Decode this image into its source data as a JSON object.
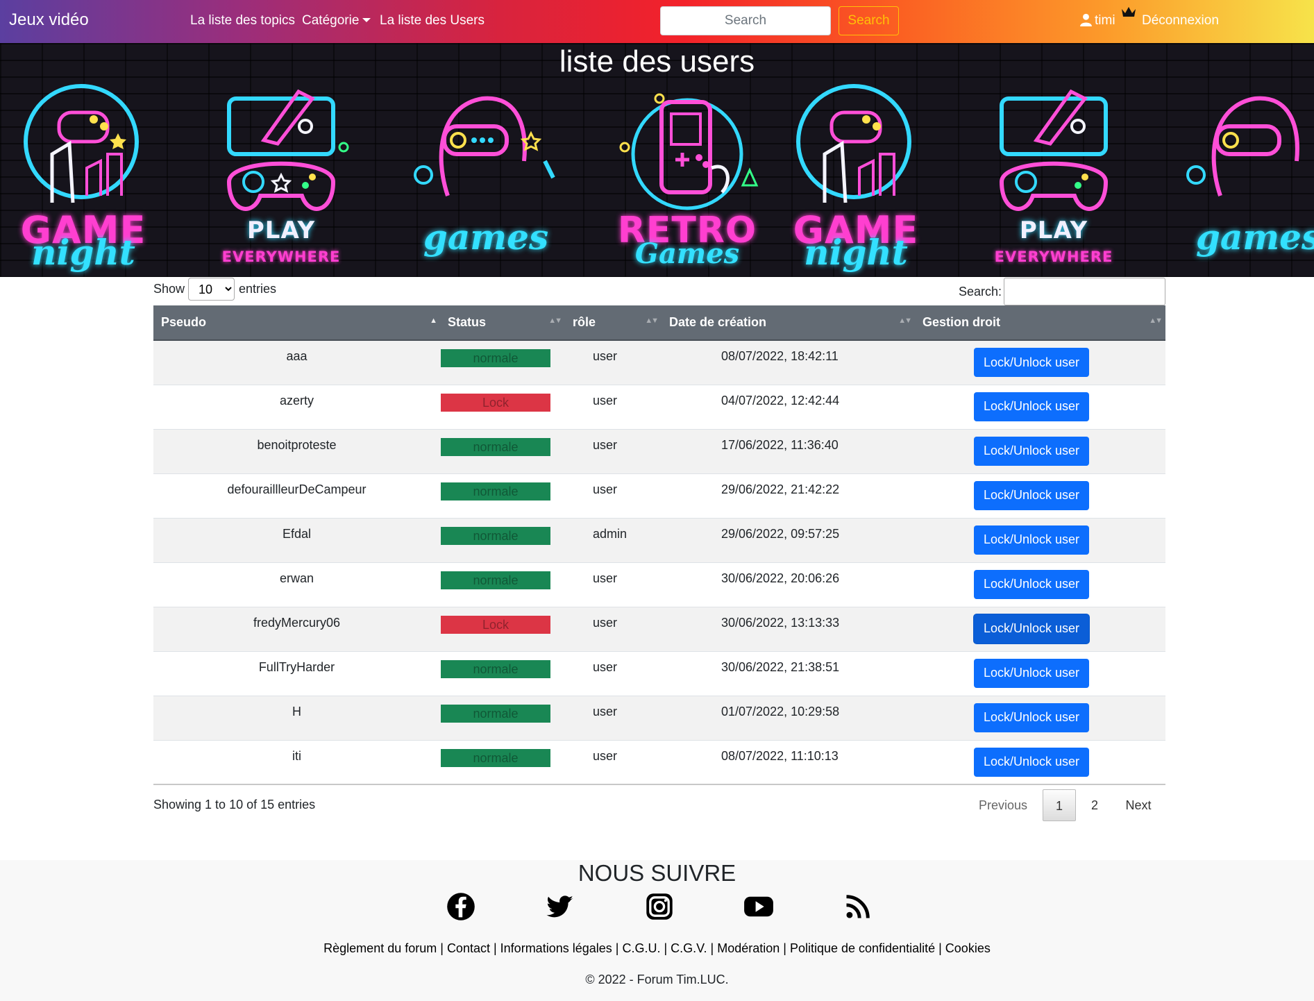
{
  "navbar": {
    "brand": "Jeux vidéo",
    "links": [
      "La liste des topics",
      "Catégorie",
      "La liste des Users"
    ],
    "search_placeholder": "Search",
    "search_button": "Search",
    "username": "timi",
    "logout": "Déconnexion"
  },
  "banner": {
    "title": "liste des users",
    "neon_words": {
      "game": "GAME",
      "night": "night",
      "play": "PLAY",
      "everywhere": "EVERYWHERE",
      "games": "games",
      "retro": "RETRO",
      "retro_games": "Games"
    }
  },
  "table": {
    "show_label": "Show",
    "entries_label": "entries",
    "page_length": "10",
    "filter_label": "Search:",
    "columns": [
      "Pseudo",
      "Status",
      "rôle",
      "Date de création",
      "Gestion droit"
    ],
    "button_label": "Lock/Unlock user",
    "rows": [
      {
        "pseudo": "aaa",
        "status": "normale",
        "role": "user",
        "date": "08/07/2022, 18:42:11"
      },
      {
        "pseudo": "azerty",
        "status": "Lock",
        "role": "user",
        "date": "04/07/2022, 12:42:44"
      },
      {
        "pseudo": "benoitproteste",
        "status": "normale",
        "role": "user",
        "date": "17/06/2022, 11:36:40"
      },
      {
        "pseudo": "defouraillleurDeCampeur",
        "status": "normale",
        "role": "user",
        "date": "29/06/2022, 21:42:22"
      },
      {
        "pseudo": "Efdal",
        "status": "normale",
        "role": "admin",
        "date": "29/06/2022, 09:57:25"
      },
      {
        "pseudo": "erwan",
        "status": "normale",
        "role": "user",
        "date": "30/06/2022, 20:06:26"
      },
      {
        "pseudo": "fredyMercury06",
        "status": "Lock",
        "role": "user",
        "date": "30/06/2022, 13:13:33"
      },
      {
        "pseudo": "FullTryHarder",
        "status": "normale",
        "role": "user",
        "date": "30/06/2022, 21:38:51"
      },
      {
        "pseudo": "H",
        "status": "normale",
        "role": "user",
        "date": "01/07/2022, 10:29:58"
      },
      {
        "pseudo": "iti",
        "status": "normale",
        "role": "user",
        "date": "08/07/2022, 11:10:13"
      }
    ],
    "info": "Showing 1 to 10 of 15 entries",
    "pagination": {
      "previous": "Previous",
      "pages": [
        "1",
        "2"
      ],
      "current": "1",
      "next": "Next"
    }
  },
  "footer": {
    "follow_title": "NOUS SUIVRE",
    "social_icons": [
      "facebook-icon",
      "twitter-icon",
      "instagram-icon",
      "youtube-icon",
      "rss-icon"
    ],
    "links": [
      "Règlement du forum",
      "Contact",
      "Informations légales",
      "C.G.U.",
      "C.G.V.",
      "Modération",
      "Politique de confidentialité",
      "Cookies"
    ],
    "copyright": "© 2022 - Forum Tim.LUC."
  },
  "colors": {
    "primary": "#0d6efd",
    "success": "#198754",
    "danger": "#dc3545",
    "warning": "#ffc107",
    "table_header": "#636b74"
  }
}
